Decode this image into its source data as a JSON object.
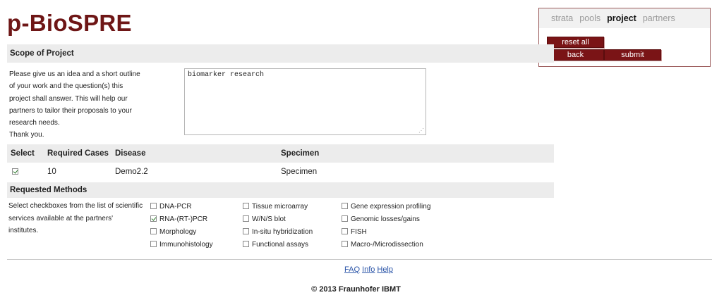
{
  "header": {
    "title": "p-BioSPRE"
  },
  "nav": {
    "tabs": [
      "strata",
      "pools",
      "project",
      "partners"
    ],
    "active": "project",
    "reset_label": "reset all",
    "back_label": "back",
    "submit_label": "submit"
  },
  "scope": {
    "heading": "Scope of Project",
    "lines": [
      "Please give us an idea and a short outline",
      "of your work and the question(s) this",
      "project shall answer. This will help our",
      "partners to tailor their proposals to your",
      "research needs.",
      "Thank you."
    ],
    "textarea_value": "biomarker research"
  },
  "table": {
    "headers": [
      "Select",
      "Required Cases",
      "Disease",
      "Specimen"
    ],
    "rows": [
      {
        "selected": true,
        "required_cases": "10",
        "disease": "Demo2.2",
        "specimen": "Specimen"
      }
    ]
  },
  "methods": {
    "heading": "Requested Methods",
    "lines": [
      "Select checkboxes from the list of scientific",
      "services available at the partners'",
      "institutes."
    ],
    "columns": [
      [
        {
          "label": "DNA-PCR",
          "checked": false
        },
        {
          "label": "RNA-(RT-)PCR",
          "checked": true
        },
        {
          "label": "Morphology",
          "checked": false
        },
        {
          "label": "Immunohistology",
          "checked": false
        }
      ],
      [
        {
          "label": "Tissue microarray",
          "checked": false
        },
        {
          "label": "W/N/S blot",
          "checked": false
        },
        {
          "label": "In-situ hybridization",
          "checked": false
        },
        {
          "label": "Functional assays",
          "checked": false
        }
      ],
      [
        {
          "label": "Gene expression profiling",
          "checked": false
        },
        {
          "label": "Genomic losses/gains",
          "checked": false
        },
        {
          "label": "FISH",
          "checked": false
        },
        {
          "label": "Macro-/Microdissection",
          "checked": false
        }
      ]
    ]
  },
  "footer": {
    "links": [
      "FAQ",
      "Info",
      "Help"
    ],
    "copyright": "© 2013 Fraunhofer IBMT"
  }
}
